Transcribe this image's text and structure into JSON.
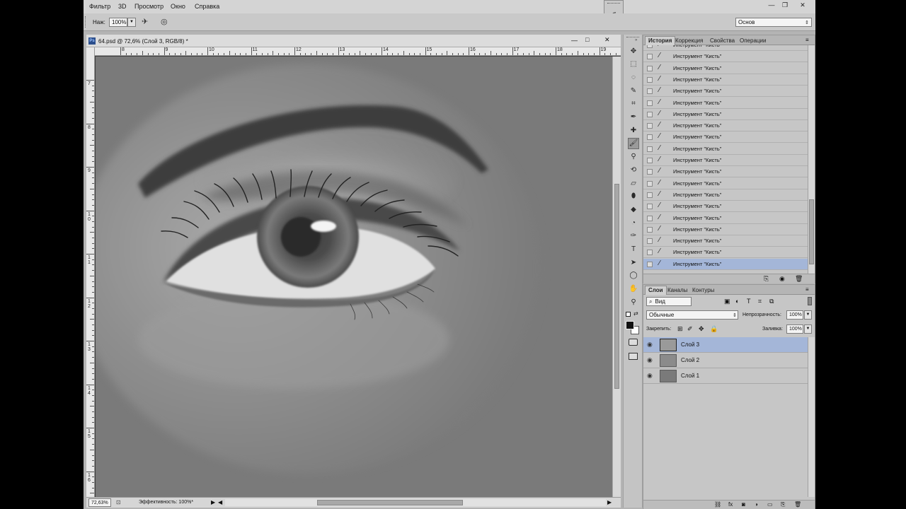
{
  "menubar": {
    "items": [
      "Фильтр",
      "3D",
      "Просмотр",
      "Окно",
      "Справка"
    ],
    "workspace": "Основ"
  },
  "options": {
    "pressure_label": "Наж:",
    "pressure_value": "100%"
  },
  "document": {
    "title": "64.psd @ 72,6% (Слой 3, RGB/8) *",
    "h_ruler": [
      "8",
      "9",
      "10",
      "11",
      "12",
      "13",
      "14",
      "15",
      "16",
      "17",
      "18",
      "19"
    ],
    "v_ruler": [
      "7",
      "8",
      "9",
      "1\n0",
      "1\n1",
      "1\n2",
      "1\n3",
      "1\n4",
      "1\n5",
      "1\n6"
    ]
  },
  "status": {
    "zoom": "72,63%",
    "efficiency": "Эффективность: 100%*"
  },
  "history_panel": {
    "tabs": [
      "История",
      "Коррекция",
      "Свойства",
      "Операции"
    ],
    "row_label": "Инструмент \"Кисть\"",
    "row_count": 20,
    "selected_index": 19
  },
  "layers_panel": {
    "tabs": [
      "Слои",
      "Каналы",
      "Контуры"
    ],
    "filter": "Вид",
    "blend_mode": "Обычные",
    "opacity_label": "Непрозрачность:",
    "opacity_value": "100%",
    "lock_label": "Закрепить:",
    "fill_label": "Заливка:",
    "fill_value": "100%",
    "layers": [
      {
        "name": "Слой 3",
        "selected": true
      },
      {
        "name": "Слой 2",
        "selected": false
      },
      {
        "name": "Слой 1",
        "selected": false
      }
    ]
  },
  "colors": {
    "selection": "#a4b6d8",
    "panel_bg": "#c6c6c6",
    "canvas_bg": "#777777"
  },
  "tools": [
    "move-icon",
    "marquee-icon",
    "lasso-icon",
    "quick-select-icon",
    "crop-icon",
    "eyedropper-icon",
    "healing-icon",
    "brush-icon",
    "clone-stamp-icon",
    "history-brush-icon",
    "eraser-icon",
    "paint-bucket-icon",
    "blur-icon",
    "dodge-icon",
    "pen-icon",
    "type-icon",
    "path-select-icon",
    "ellipse-icon",
    "hand-icon",
    "zoom-icon"
  ]
}
